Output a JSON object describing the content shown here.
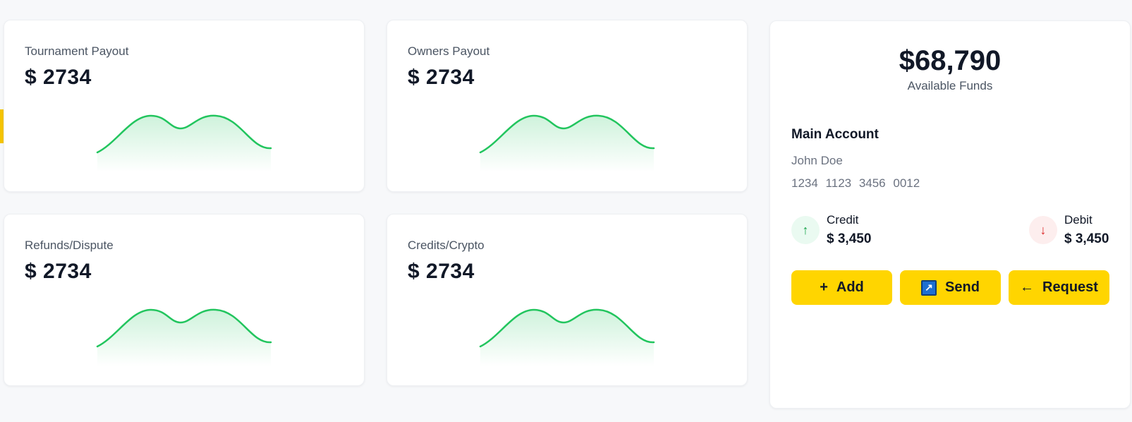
{
  "stat_cards": [
    {
      "title": "Tournament Payout",
      "value": "$ 2734"
    },
    {
      "title": "Owners Payout",
      "value": "$ 2734"
    },
    {
      "title": "Refunds/Dispute",
      "value": "$ 2734"
    },
    {
      "title": "Credits/Crypto",
      "value": "$ 2734"
    }
  ],
  "funds": {
    "amount": "$68,790",
    "label": "Available Funds",
    "account_title": "Main Account",
    "holder": "John Doe",
    "number": "1234 1123 3456 0012",
    "credit": {
      "label": "Credit",
      "value": "$ 3,450",
      "icon": "arrow-up-icon",
      "glyph": "↑",
      "color": "#16a34a"
    },
    "debit": {
      "label": "Debit",
      "value": "$ 3,450",
      "icon": "arrow-down-icon",
      "glyph": "↓",
      "color": "#dc2626"
    }
  },
  "actions": {
    "add": {
      "label": "Add",
      "glyph": "+",
      "icon": "plus-icon"
    },
    "send": {
      "label": "Send",
      "glyph": "↗",
      "icon": "send-arrow-icon"
    },
    "request": {
      "label": "Request",
      "glyph": "←",
      "icon": "arrow-left-icon"
    }
  },
  "colors": {
    "accent": "#ffd500",
    "sparkline": "#22c55e",
    "text_primary": "#111827",
    "text_secondary": "#4b5563"
  }
}
